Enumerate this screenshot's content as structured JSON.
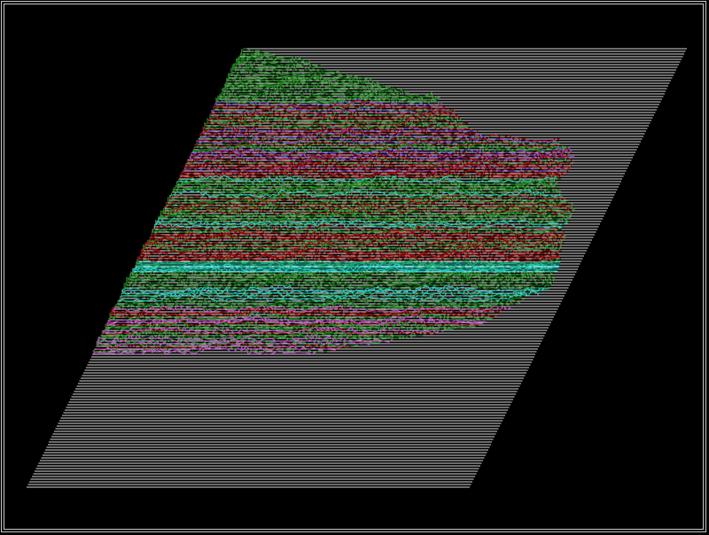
{
  "scene": {
    "background_color": "#000000",
    "frame_color": "#c8c8c8",
    "scanline_color": "#d8d8d8",
    "terrain_palette": {
      "vegetation": "#1f8a1f",
      "vegetation_dark": "#0f5a14",
      "ridge": "#9a1010",
      "water": "#22c8c0",
      "peak": "#7a3cd8",
      "highlight": "#c84ad0"
    }
  }
}
